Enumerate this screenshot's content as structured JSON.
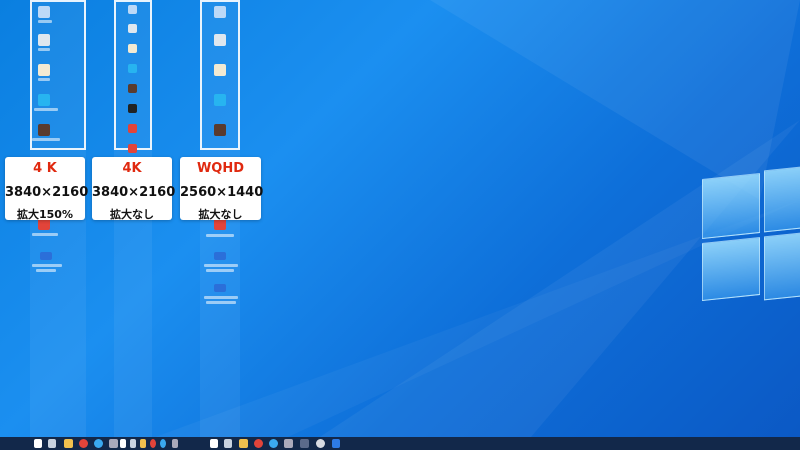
{
  "cards": [
    {
      "title": "4 K",
      "size": "3840×2160",
      "scale": "拡大150%"
    },
    {
      "title": "4K",
      "size": "3840×2160",
      "scale": "拡大なし"
    },
    {
      "title": "WQHD",
      "size": "2560×1440",
      "scale": "拡大なし"
    }
  ],
  "colors": {
    "accent_red": "#e0290f",
    "desktop_blue": "#0a7fe0",
    "taskbar": "#12284a"
  },
  "icons": [
    "recycle-bin-icon",
    "document-icon",
    "app-shortcut-icon",
    "photo-icon",
    "monitor-icon",
    "windows-logo-icon",
    "search-icon",
    "task-view-icon",
    "folder-icon",
    "chrome-icon",
    "browser-icon"
  ]
}
